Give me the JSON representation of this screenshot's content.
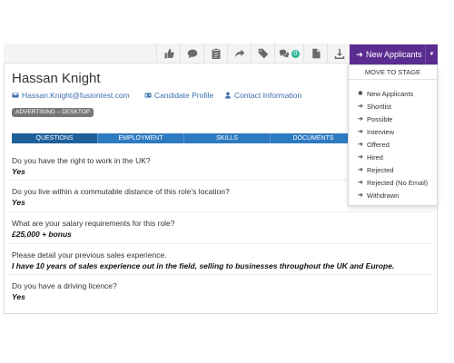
{
  "toolbar": {
    "icons": [
      "thumbs-up-icon",
      "comment-icon",
      "clipboard-icon",
      "share-icon",
      "tag-icon",
      "comments-icon",
      "document-icon",
      "download-icon"
    ],
    "comments_count": "0",
    "stage_button_label": "New Applicants"
  },
  "candidate": {
    "name": "Hassan Knight",
    "email": "Hassan.Knight@fusiontest.com",
    "profile_link": "Candidate Profile",
    "contact_link": "Contact Information",
    "tag": "ADVERTISING – DESKTOP"
  },
  "tabs": [
    "QUESTIONS",
    "EMPLOYMENT",
    "SKILLS",
    "DOCUMENTS"
  ],
  "questions": [
    {
      "q": "Do you have the right to work in the UK?",
      "a": "Yes"
    },
    {
      "q": "Do you live within a commutable distance of this role's location?",
      "a": "Yes"
    },
    {
      "q": "What are your salary requirements for this role?",
      "a": "£25,000 + bonus"
    },
    {
      "q": "Please detail your previous sales experience.",
      "a": "I have 10 years of sales experience out in the field, selling to businesses throughout the UK and Europe."
    },
    {
      "q": "Do you have a driving licence?",
      "a": "Yes"
    }
  ],
  "dropdown": {
    "header": "MOVE TO STAGE",
    "items": [
      {
        "label": "New Applicants",
        "icon": "asterisk-icon"
      },
      {
        "label": "Shortlist",
        "icon": "arrow-right-icon"
      },
      {
        "label": "Possible",
        "icon": "arrow-right-icon"
      },
      {
        "label": "Interview",
        "icon": "arrow-right-icon"
      },
      {
        "label": "Offered",
        "icon": "arrow-right-icon"
      },
      {
        "label": "Hired",
        "icon": "arrow-right-icon"
      },
      {
        "label": "Rejected",
        "icon": "arrow-right-icon"
      },
      {
        "label": "Rejected (No Email)",
        "icon": "arrow-right-icon"
      },
      {
        "label": "Withdrawn",
        "icon": "arrow-right-icon"
      }
    ]
  },
  "colors": {
    "accent": "#5c2d91",
    "tabs": "#2d7ac0",
    "tab_active": "#1f5f9a",
    "link": "#3b6ea8",
    "badge": "#2eb398"
  }
}
